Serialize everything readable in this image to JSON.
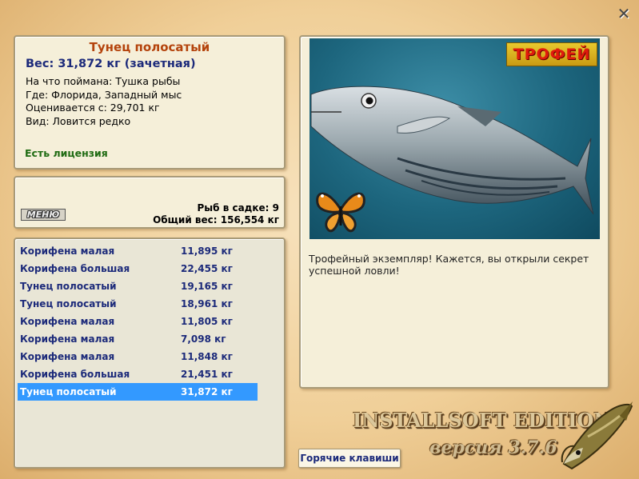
{
  "info": {
    "fish_name": "Тунец полосатый",
    "weight_line": "Вес: 31,872 кг (зачетная)",
    "bait_line": "На что поймана: Тушка рыбы",
    "location_line": "Где: Флорида, Западный мыс",
    "valued_line": "Оценивается с: 29,701 кг",
    "kind_line": "Вид: Ловится редко",
    "license": "Есть лицензия"
  },
  "keepnet": {
    "menu_label": "МЕНЮ",
    "fish_count": "Рыб в садке: 9",
    "total_weight": "Общий вес: 156,554 кг"
  },
  "catch_list": [
    {
      "name": "Корифена малая",
      "weight": "11,895 кг"
    },
    {
      "name": "Корифена большая",
      "weight": "22,455 кг"
    },
    {
      "name": "Тунец полосатый",
      "weight": "19,165 кг"
    },
    {
      "name": "Тунец полосатый",
      "weight": "18,961 кг"
    },
    {
      "name": "Корифена малая",
      "weight": "11,805 кг"
    },
    {
      "name": "Корифена малая",
      "weight": "7,098 кг"
    },
    {
      "name": "Корифена малая",
      "weight": "11,848 кг"
    },
    {
      "name": "Корифена большая",
      "weight": "21,451 кг"
    },
    {
      "name": "Тунец полосатый",
      "weight": "31,872 кг"
    }
  ],
  "selected_index": 8,
  "trophy": {
    "badge": "ТРОФЕЙ",
    "description": "Трофейный экземпляр! Кажется, вы открыли секрет успешной ловли!"
  },
  "buttons": {
    "hotkeys": "Горячие клавиши",
    "close_icon": "close-icon"
  },
  "branding": {
    "title": "INSTALLSOFT EDITION",
    "version": "версия 3.7.6"
  }
}
